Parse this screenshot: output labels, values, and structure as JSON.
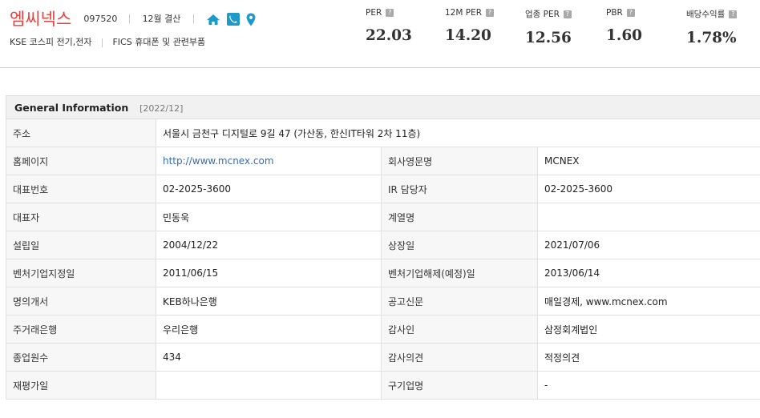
{
  "header": {
    "company_name": "엠씨넥스",
    "ticker": "097520",
    "settlement": "12월 결산",
    "icons": [
      "home-icon",
      "phone-icon",
      "location-pin-icon"
    ],
    "icon_color": "#1e9ac9",
    "market": "KSE  코스피 전기,전자",
    "fics": "FICS 휴대폰 및 관련부품"
  },
  "metrics": [
    {
      "label": "PER",
      "value": "22.03"
    },
    {
      "label": "12M PER",
      "value": "14.20"
    },
    {
      "label": "업종 PER",
      "value": "12.56"
    },
    {
      "label": "PBR",
      "value": "1.60"
    },
    {
      "label": "배당수익률",
      "value": "1.78%"
    }
  ],
  "help_glyph": "?",
  "general_info": {
    "title": "General Information",
    "date": "[2022/12]",
    "address_label": "주소",
    "address_value": "서울시 금천구 디지털로 9길 47 (가산동, 한신IT타워 2차 11층)",
    "rows": [
      {
        "l1": "홈페이지",
        "v1": "http://www.mcnex.com",
        "l2": "회사영문명",
        "v2": "MCNEX"
      },
      {
        "l1": "대표번호",
        "v1": "02-2025-3600",
        "l2": "IR 담당자",
        "v2": "02-2025-3600"
      },
      {
        "l1": "대표자",
        "v1": "민동욱",
        "l2": "계열명",
        "v2": ""
      },
      {
        "l1": "설립일",
        "v1": "2004/12/22",
        "l2": "상장일",
        "v2": "2021/07/06"
      },
      {
        "l1": "벤처기업지정일",
        "v1": "2011/06/15",
        "l2": "벤처기업해제(예정)일",
        "v2": "2013/06/14"
      },
      {
        "l1": "명의개서",
        "v1": "KEB하나은행",
        "l2": "공고신문",
        "v2": "매일경제, www.mcnex.com"
      },
      {
        "l1": "주거래은행",
        "v1": "우리은행",
        "l2": "감사인",
        "v2": "삼정회계법인"
      },
      {
        "l1": "종업원수",
        "v1": "434",
        "l2": "감사의견",
        "v2": "적정의견"
      },
      {
        "l1": "재평가일",
        "v1": "",
        "l2": "구기업명",
        "v2": "-"
      }
    ]
  }
}
